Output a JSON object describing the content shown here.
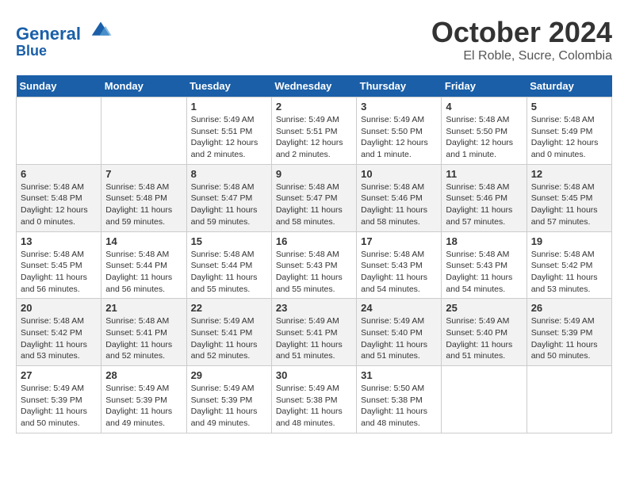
{
  "header": {
    "logo_line1": "General",
    "logo_line2": "Blue",
    "month": "October 2024",
    "location": "El Roble, Sucre, Colombia"
  },
  "days_of_week": [
    "Sunday",
    "Monday",
    "Tuesday",
    "Wednesday",
    "Thursday",
    "Friday",
    "Saturday"
  ],
  "weeks": [
    [
      {
        "day": "",
        "info": ""
      },
      {
        "day": "",
        "info": ""
      },
      {
        "day": "1",
        "info": "Sunrise: 5:49 AM\nSunset: 5:51 PM\nDaylight: 12 hours\nand 2 minutes."
      },
      {
        "day": "2",
        "info": "Sunrise: 5:49 AM\nSunset: 5:51 PM\nDaylight: 12 hours\nand 2 minutes."
      },
      {
        "day": "3",
        "info": "Sunrise: 5:49 AM\nSunset: 5:50 PM\nDaylight: 12 hours\nand 1 minute."
      },
      {
        "day": "4",
        "info": "Sunrise: 5:48 AM\nSunset: 5:50 PM\nDaylight: 12 hours\nand 1 minute."
      },
      {
        "day": "5",
        "info": "Sunrise: 5:48 AM\nSunset: 5:49 PM\nDaylight: 12 hours\nand 0 minutes."
      }
    ],
    [
      {
        "day": "6",
        "info": "Sunrise: 5:48 AM\nSunset: 5:48 PM\nDaylight: 12 hours\nand 0 minutes."
      },
      {
        "day": "7",
        "info": "Sunrise: 5:48 AM\nSunset: 5:48 PM\nDaylight: 11 hours\nand 59 minutes."
      },
      {
        "day": "8",
        "info": "Sunrise: 5:48 AM\nSunset: 5:47 PM\nDaylight: 11 hours\nand 59 minutes."
      },
      {
        "day": "9",
        "info": "Sunrise: 5:48 AM\nSunset: 5:47 PM\nDaylight: 11 hours\nand 58 minutes."
      },
      {
        "day": "10",
        "info": "Sunrise: 5:48 AM\nSunset: 5:46 PM\nDaylight: 11 hours\nand 58 minutes."
      },
      {
        "day": "11",
        "info": "Sunrise: 5:48 AM\nSunset: 5:46 PM\nDaylight: 11 hours\nand 57 minutes."
      },
      {
        "day": "12",
        "info": "Sunrise: 5:48 AM\nSunset: 5:45 PM\nDaylight: 11 hours\nand 57 minutes."
      }
    ],
    [
      {
        "day": "13",
        "info": "Sunrise: 5:48 AM\nSunset: 5:45 PM\nDaylight: 11 hours\nand 56 minutes."
      },
      {
        "day": "14",
        "info": "Sunrise: 5:48 AM\nSunset: 5:44 PM\nDaylight: 11 hours\nand 56 minutes."
      },
      {
        "day": "15",
        "info": "Sunrise: 5:48 AM\nSunset: 5:44 PM\nDaylight: 11 hours\nand 55 minutes."
      },
      {
        "day": "16",
        "info": "Sunrise: 5:48 AM\nSunset: 5:43 PM\nDaylight: 11 hours\nand 55 minutes."
      },
      {
        "day": "17",
        "info": "Sunrise: 5:48 AM\nSunset: 5:43 PM\nDaylight: 11 hours\nand 54 minutes."
      },
      {
        "day": "18",
        "info": "Sunrise: 5:48 AM\nSunset: 5:43 PM\nDaylight: 11 hours\nand 54 minutes."
      },
      {
        "day": "19",
        "info": "Sunrise: 5:48 AM\nSunset: 5:42 PM\nDaylight: 11 hours\nand 53 minutes."
      }
    ],
    [
      {
        "day": "20",
        "info": "Sunrise: 5:48 AM\nSunset: 5:42 PM\nDaylight: 11 hours\nand 53 minutes."
      },
      {
        "day": "21",
        "info": "Sunrise: 5:48 AM\nSunset: 5:41 PM\nDaylight: 11 hours\nand 52 minutes."
      },
      {
        "day": "22",
        "info": "Sunrise: 5:49 AM\nSunset: 5:41 PM\nDaylight: 11 hours\nand 52 minutes."
      },
      {
        "day": "23",
        "info": "Sunrise: 5:49 AM\nSunset: 5:41 PM\nDaylight: 11 hours\nand 51 minutes."
      },
      {
        "day": "24",
        "info": "Sunrise: 5:49 AM\nSunset: 5:40 PM\nDaylight: 11 hours\nand 51 minutes."
      },
      {
        "day": "25",
        "info": "Sunrise: 5:49 AM\nSunset: 5:40 PM\nDaylight: 11 hours\nand 51 minutes."
      },
      {
        "day": "26",
        "info": "Sunrise: 5:49 AM\nSunset: 5:39 PM\nDaylight: 11 hours\nand 50 minutes."
      }
    ],
    [
      {
        "day": "27",
        "info": "Sunrise: 5:49 AM\nSunset: 5:39 PM\nDaylight: 11 hours\nand 50 minutes."
      },
      {
        "day": "28",
        "info": "Sunrise: 5:49 AM\nSunset: 5:39 PM\nDaylight: 11 hours\nand 49 minutes."
      },
      {
        "day": "29",
        "info": "Sunrise: 5:49 AM\nSunset: 5:39 PM\nDaylight: 11 hours\nand 49 minutes."
      },
      {
        "day": "30",
        "info": "Sunrise: 5:49 AM\nSunset: 5:38 PM\nDaylight: 11 hours\nand 48 minutes."
      },
      {
        "day": "31",
        "info": "Sunrise: 5:50 AM\nSunset: 5:38 PM\nDaylight: 11 hours\nand 48 minutes."
      },
      {
        "day": "",
        "info": ""
      },
      {
        "day": "",
        "info": ""
      }
    ]
  ]
}
